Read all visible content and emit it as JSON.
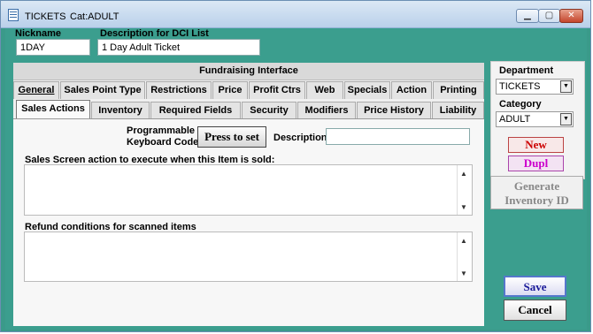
{
  "window": {
    "title": "TICKETS",
    "subtitle": "Cat:ADULT"
  },
  "header": {
    "nickname_label": "Nickname",
    "nickname_value": "1DAY",
    "description_label": "Description for DCI List",
    "description_value": "1 Day Adult Ticket"
  },
  "fundraising_label": "Fundraising Interface",
  "tabs_row1": [
    "General",
    "Sales Point Type",
    "Restrictions",
    "Price",
    "Profit Ctrs",
    "Web",
    "Specials",
    "Action",
    "Printing"
  ],
  "tabs_row2": [
    "Sales Actions",
    "Inventory",
    "Required Fields",
    "Security",
    "Modifiers",
    "Price History",
    "Liability"
  ],
  "sales_actions": {
    "keyboard_label_1": "Programmable",
    "keyboard_label_2": "Keyboard Code",
    "press_button": "Press to set",
    "description_label": "Description",
    "description_value": "",
    "action_label": "Sales Screen action to execute when this Item is sold:",
    "refund_label": "Refund conditions for scanned items"
  },
  "side": {
    "department_label": "Department",
    "department_value": "TICKETS",
    "category_label": "Category",
    "category_value": "ADULT",
    "new_button": "New",
    "dupl_button": "Dupl",
    "generate_button_1": "Generate",
    "generate_button_2": "Inventory ID",
    "save_button": "Save",
    "cancel_button": "Cancel"
  },
  "colors": {
    "accent": "#3b9e8e",
    "new": "#cc0000",
    "dupl": "#cc00cc",
    "save": "#1a1a99"
  }
}
